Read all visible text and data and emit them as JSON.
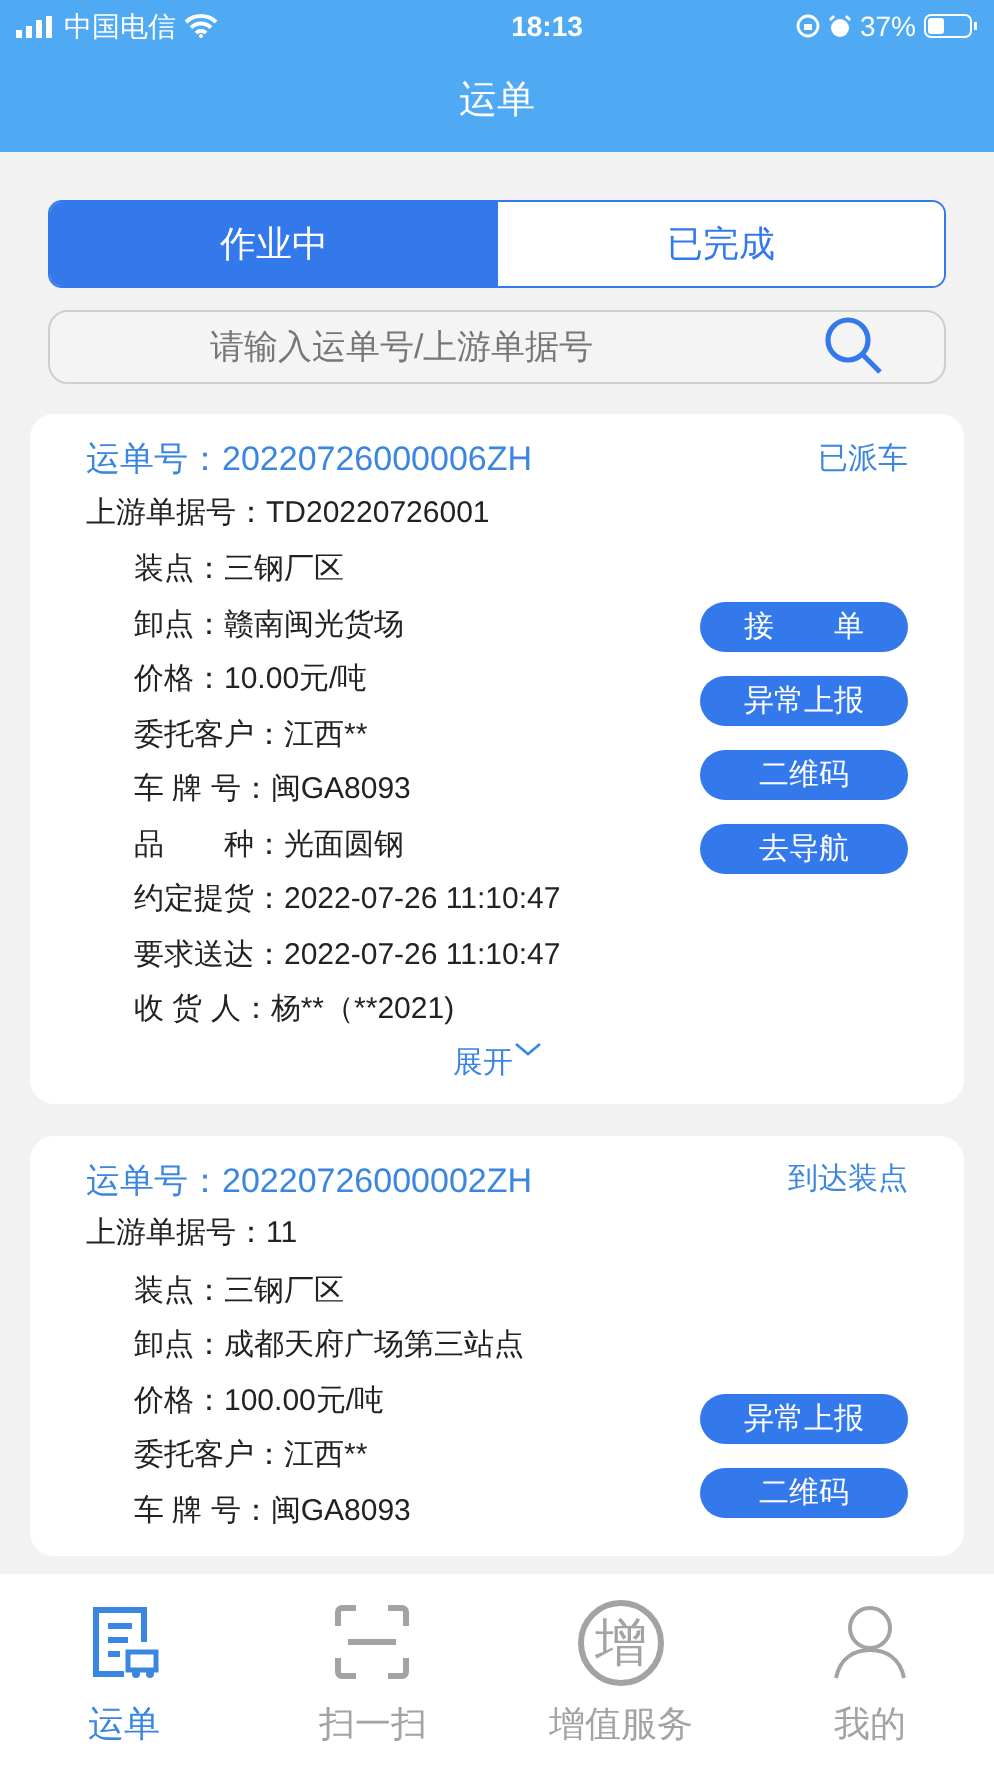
{
  "status_bar": {
    "carrier": "中国电信",
    "time": "18:13",
    "battery": "37%"
  },
  "header": {
    "title": "运单"
  },
  "tabs": [
    {
      "label": "作业中",
      "selected": true
    },
    {
      "label": "已完成",
      "selected": false
    }
  ],
  "search": {
    "placeholder": "请输入运单号/上游单据号"
  },
  "orders": [
    {
      "number_label": "运单号：",
      "number": "20220726000006ZH",
      "status": "已派车",
      "upstream_label": "上游单据号：",
      "upstream": "TD20220726001",
      "fields": [
        {
          "label": "装点：",
          "value": "三钢厂区"
        },
        {
          "label": "卸点：",
          "value": "赣南闽光货场"
        },
        {
          "label": "价格：",
          "value": "10.00元/吨"
        },
        {
          "label": "委托客户：",
          "value": "江西**"
        },
        {
          "label": "车 牌 号：",
          "value": "闽GA8093"
        },
        {
          "label": "品　　种：",
          "value": "光面圆钢"
        },
        {
          "label": "约定提货：",
          "value": "2022-07-26 11:10:47"
        },
        {
          "label": "要求送达：",
          "value": "2022-07-26 11:10:47"
        },
        {
          "label": "收 货 人：",
          "value": "杨**（**2021)"
        }
      ],
      "buttons": [
        "接　　单",
        "异常上报",
        "二维码",
        "去导航"
      ],
      "expand": "展开"
    },
    {
      "number_label": "运单号：",
      "number": "20220726000002ZH",
      "status": "到达装点",
      "upstream_label": "上游单据号：",
      "upstream": "11",
      "fields": [
        {
          "label": "装点：",
          "value": "三钢厂区"
        },
        {
          "label": "卸点：",
          "value": "成都天府广场第三站点"
        },
        {
          "label": "价格：",
          "value": "100.00元/吨"
        },
        {
          "label": "委托客户：",
          "value": "江西**"
        },
        {
          "label": "车 牌 号：",
          "value": "闽GA8093"
        }
      ],
      "buttons": [
        "异常上报",
        "二维码"
      ]
    }
  ],
  "tab_bar": [
    {
      "kind": "waybill",
      "label": "运单",
      "selected": true
    },
    {
      "kind": "scan",
      "label": "扫一扫",
      "selected": false
    },
    {
      "kind": "value",
      "label": "增值服务",
      "glyph": "增",
      "selected": false
    },
    {
      "kind": "me",
      "label": "我的",
      "selected": false
    }
  ]
}
